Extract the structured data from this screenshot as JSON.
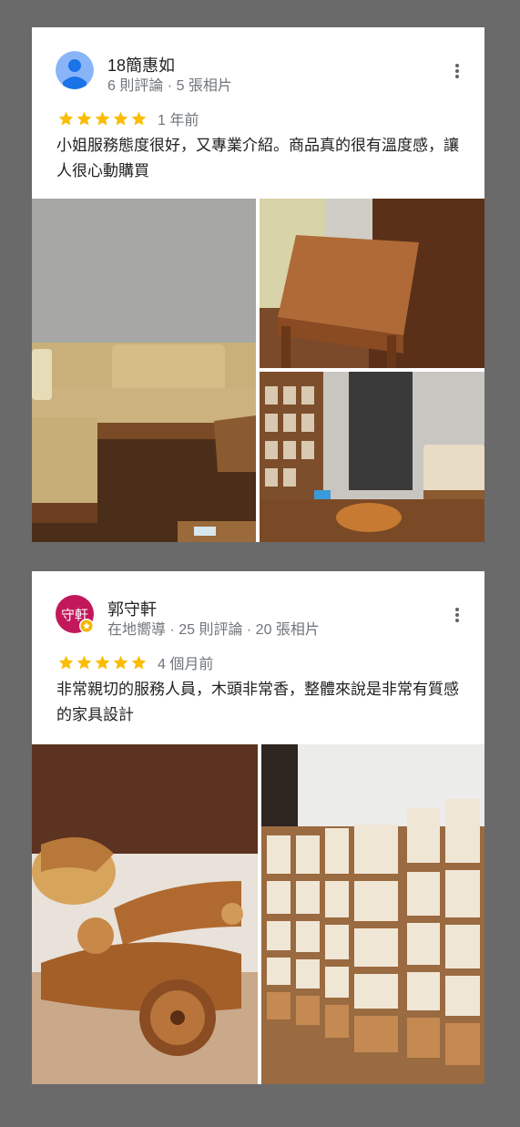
{
  "reviews": [
    {
      "author": "18簡惠如",
      "meta": "6 則評論 · 5 張相片",
      "rating": 5,
      "time": "1 年前",
      "text": "小姐服務態度很好，又專業介紹。商品真的很有溫度感，讓人很心動購買",
      "avatar": {
        "type": "default-person",
        "color": "#8ab4f8"
      }
    },
    {
      "author": "郭守軒",
      "meta": "在地嚮導 · 25 則評論 · 20 張相片",
      "rating": 5,
      "time": "4 個月前",
      "text": "非常親切的服務人員，木頭非常香，整體來說是非常有質感的家具設計",
      "avatar": {
        "type": "initials",
        "initials": "守軒",
        "color": "#c2185b",
        "badge": "local-guide-star"
      }
    }
  ],
  "colors": {
    "star": "#fbbc04",
    "background": "#6a6a6a",
    "card": "#ffffff"
  },
  "photo_subjects": [
    "sofa-and-coffee-table",
    "wooden-bench",
    "showroom-shelves-and-sofa",
    "wooden-motorcycle-sidecar-model",
    "wooden-display-shelves"
  ]
}
